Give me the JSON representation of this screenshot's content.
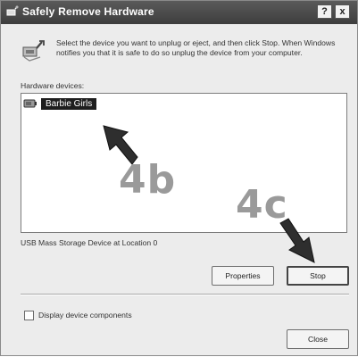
{
  "window": {
    "title": "Safely Remove Hardware",
    "help_button": "?",
    "close_button": "x"
  },
  "intro": {
    "icon": "safely-remove-hardware-icon",
    "text": "Select the device you want to unplug or eject, and then click Stop. When Windows notifies you that it is safe to do so unplug the device from your computer."
  },
  "hardware_devices": {
    "label": "Hardware devices:",
    "items": [
      {
        "label": "Barbie Girls",
        "icon": "usb-drive-icon",
        "selected": true
      }
    ]
  },
  "device_location": "USB Mass Storage Device at Location 0",
  "buttons": {
    "properties": "Properties",
    "stop": "Stop",
    "close": "Close"
  },
  "checkbox": {
    "label": "Display device components",
    "checked": false
  },
  "annotations": {
    "step_b": "4b",
    "step_c": "4c"
  }
}
